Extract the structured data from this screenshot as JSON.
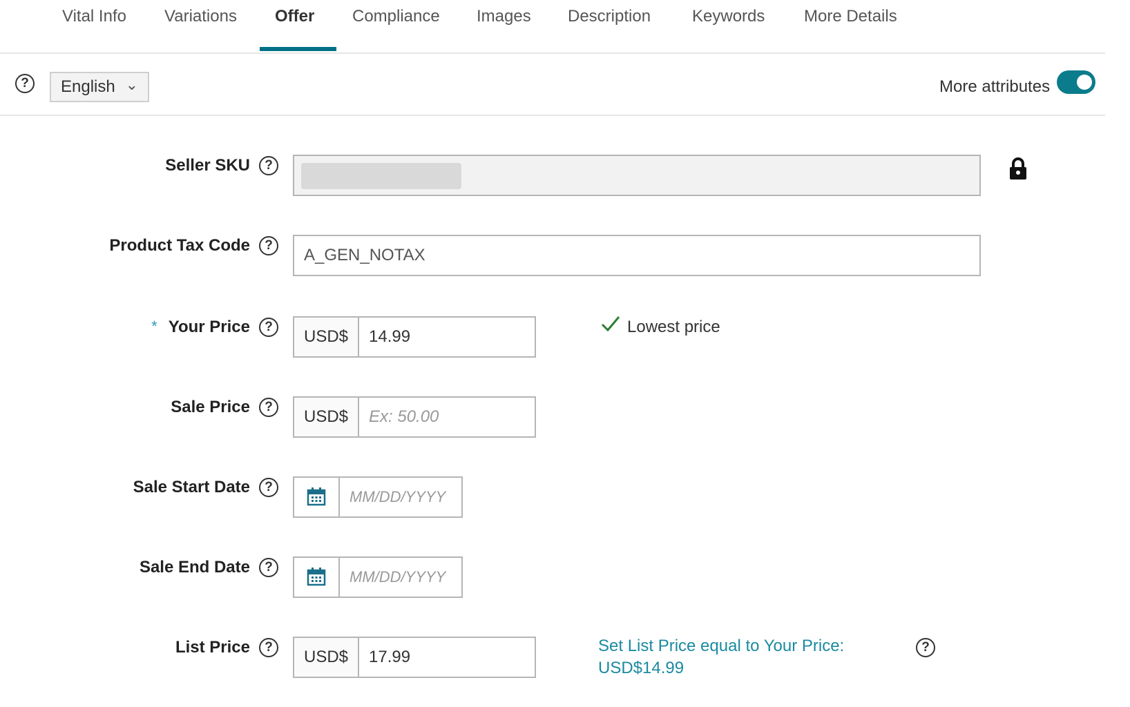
{
  "tabs": [
    "Vital Info",
    "Variations",
    "Offer",
    "Compliance",
    "Images",
    "Description",
    "Keywords",
    "More Details"
  ],
  "active_tab": "Offer",
  "toolbar": {
    "language": "English",
    "more_attributes_label": "More attributes",
    "more_attributes_on": true
  },
  "fields": {
    "seller_sku": {
      "label": "Seller SKU",
      "locked": true
    },
    "tax_code": {
      "label": "Product Tax Code",
      "value": "A_GEN_NOTAX"
    },
    "your_price": {
      "required_mark": "*",
      "label": "Your Price",
      "currency": "USD$",
      "value": "14.99"
    },
    "sale_price": {
      "label": "Sale Price",
      "currency": "USD$",
      "placeholder": "Ex: 50.00"
    },
    "sale_start": {
      "label": "Sale Start Date",
      "placeholder": "MM/DD/YYYY"
    },
    "sale_end": {
      "label": "Sale End Date",
      "placeholder": "MM/DD/YYYY"
    },
    "list_price": {
      "label": "List Price",
      "currency": "USD$",
      "value": "17.99"
    }
  },
  "lowest_price_text": "Lowest price",
  "set_list_price": {
    "line1": "Set List Price equal to Your Price:",
    "line2": "USD$14.99"
  },
  "colors": {
    "accent": "#007185",
    "toggle": "#0b7c8c",
    "link": "#1b8aa0",
    "check": "#2e7d32"
  }
}
